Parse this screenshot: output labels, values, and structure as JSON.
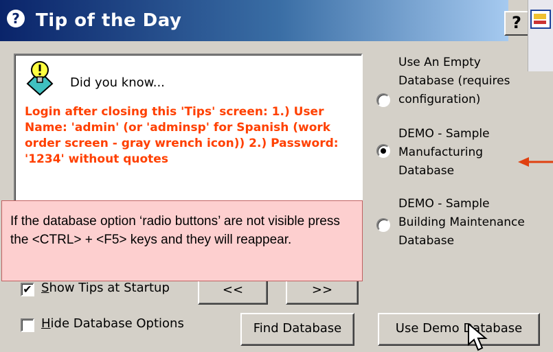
{
  "window": {
    "title": "Tip of the Day",
    "help_button": "?"
  },
  "tip": {
    "heading": "Did you know...",
    "text": "Login after closing this 'Tips' screen: 1.) User Name: 'admin' (or 'adminsp' for Spanish (work order screen - gray wrench icon)) 2.) Password: '1234' without quotes"
  },
  "database_options": [
    {
      "label": "Use An Empty\nDatabase (requires\nconfiguration)",
      "selected": false
    },
    {
      "label": "DEMO - Sample\nManufacturing\nDatabase",
      "selected": true
    },
    {
      "label": "DEMO - Sample\nBuilding Maintenance\nDatabase",
      "selected": false
    }
  ],
  "show_tips": {
    "label_first": "S",
    "label_rest": "how Tips at Startup",
    "checked": true,
    "mark": "✔"
  },
  "hide_db": {
    "label_first": "H",
    "label_rest": "ide Database Options",
    "checked": false
  },
  "buttons": {
    "prev": "<<",
    "next": ">>",
    "find_db": "Find  Database",
    "use_demo": "Use Demo Database"
  },
  "callout": {
    "text": "If the database option ‘radio buttons’ are not visible press the <CTRL> + <F5> keys and they will reappear."
  },
  "colors": {
    "tip_text": "#ff4000",
    "arrow": "#e04010",
    "callout_bg": "#fdcfcf"
  }
}
